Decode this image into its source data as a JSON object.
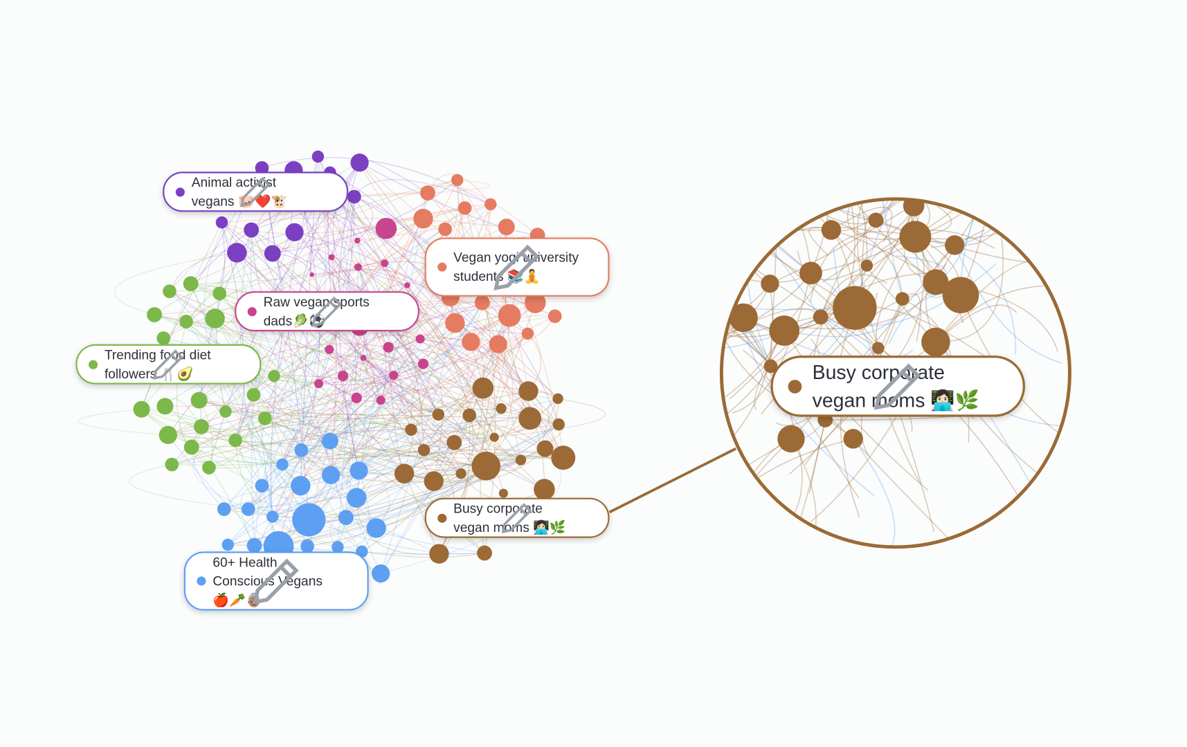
{
  "segments": [
    {
      "id": "animal",
      "label": "Animal activist vegans 🐷❤️🐮",
      "color": "#7b40c2"
    },
    {
      "id": "yogi",
      "label": "Vegan yogi university students 📚🧘",
      "color": "#e57c62"
    },
    {
      "id": "sports",
      "label": "Raw vegan sports dads🥬⚽",
      "color": "#c8448f"
    },
    {
      "id": "trending",
      "label": "Trending food diet followers 🍴🥑",
      "color": "#7cb84a"
    },
    {
      "id": "moms",
      "label": "Busy corporate vegan moms 👩🏻‍💻🌿",
      "color": "#9b6a36"
    },
    {
      "id": "health",
      "label": "60+ Health Conscious Vegans 🍎🥕👵🏽",
      "color": "#5da0f2"
    }
  ],
  "zoom_callout": {
    "segment": "moms",
    "label": "Busy corporate vegan moms 👩🏻‍💻🌿",
    "color": "#9b6a36"
  },
  "icons": {
    "edit": "pencil-icon"
  }
}
